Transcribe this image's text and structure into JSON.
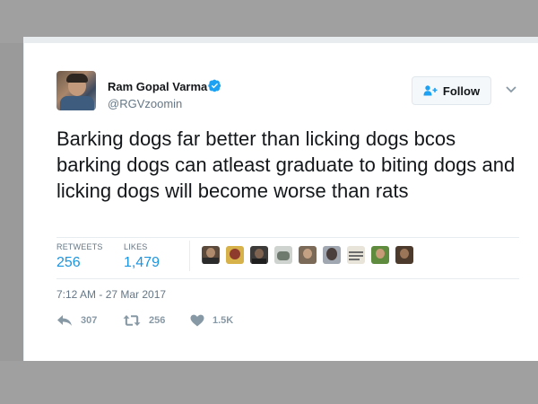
{
  "tweet": {
    "author_name": "Ram Gopal Varma",
    "author_handle": "@RGVzoomin",
    "follow_label": "Follow",
    "text": "Barking dogs far better than licking dogs bcos barking dogs can atleast graduate to biting dogs and licking dogs will become worse than rats",
    "timestamp": "7:12 AM - 27 Mar 2017"
  },
  "stats": {
    "retweets_label": "RETWEETS",
    "retweets_value": "256",
    "likes_label": "LIKES",
    "likes_value": "1,479"
  },
  "actions": {
    "reply_count": "307",
    "retweet_count": "256",
    "like_count": "1.5K"
  },
  "icons": [
    "verified-badge-icon",
    "follow-person-icon",
    "chevron-down-icon",
    "reply-icon",
    "retweet-icon",
    "heart-icon"
  ],
  "colors": {
    "link_blue": "#1b95e0",
    "text": "#14171a",
    "muted": "#657786",
    "action_grey": "#8899a6"
  }
}
